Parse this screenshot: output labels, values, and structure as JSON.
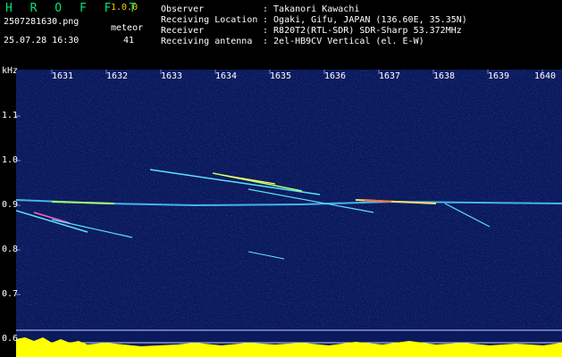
{
  "header": {
    "brand": "H R O F F T",
    "version": "1.0.0",
    "filename": "2507281630.png",
    "datetime": "25.07.28 16:30",
    "meteor_label": "meteor",
    "meteor_count": "41",
    "info": [
      {
        "label": "Observer",
        "value": ": Takanori Kawachi"
      },
      {
        "label": "Receiving Location",
        "value": ": Ogaki, Gifu, JAPAN (136.60E, 35.35N)"
      },
      {
        "label": "Receiver",
        "value": ": R820T2(RTL-SDR) SDR-Sharp 53.372MHz"
      },
      {
        "label": "Receiving antenna",
        "value": ": 2el-HB9CV Vertical (el. E-W)"
      }
    ]
  },
  "axes": {
    "y_unit": "kHz",
    "y_ticks": [
      "1.1",
      "1.0",
      "0.9",
      "0.8",
      "0.7",
      "0.6"
    ],
    "x_ticks": [
      "1631",
      "1632",
      "1633",
      "1634",
      "1635",
      "1636",
      "1637",
      "1638",
      "1639",
      "1640"
    ]
  },
  "colors": {
    "background": "#000000",
    "plot_bg": "#0b1a5c",
    "brand": "#00e676",
    "version": "#f5d000",
    "signal": "#ffff00"
  }
}
